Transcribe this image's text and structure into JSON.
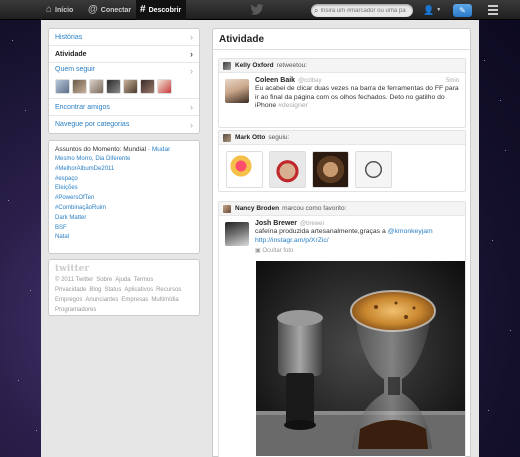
{
  "topbar": {
    "nav": [
      {
        "label": "Início",
        "icon": "home-icon"
      },
      {
        "label": "Conectar",
        "icon": "at-icon"
      },
      {
        "label": "Descobrir",
        "icon": "hash-icon"
      }
    ],
    "search_placeholder": "Insira um #marcador ou uma pal"
  },
  "sidebar": {
    "menu": [
      {
        "label": "Histórias",
        "active": false
      },
      {
        "label": "Atividade",
        "active": true
      }
    ],
    "who_to_follow": "Quem seguir",
    "menu_after": [
      {
        "label": "Encontrar amigos"
      },
      {
        "label": "Navegue por categorias"
      }
    ],
    "trends": {
      "title": "Assuntos do Momento: Mundial",
      "change": "Mudar",
      "items": [
        "Mesmo Morro, Dia Diferente",
        "#MelhorAlbumDe2011",
        "#espaço",
        "Eleições",
        "#PowersOfTen",
        "#CombinaçãoRuim",
        "Dark Matter",
        "BSF",
        "Natal"
      ]
    },
    "footer": {
      "logo": "twitter",
      "links": [
        "© 2011 Twitter",
        "Sobre",
        "Ajuda",
        "Termos",
        "Privacidade",
        "Blog",
        "Status",
        "Aplicativos",
        "Recursos",
        "Empregos",
        "Anunciantes",
        "Empresas",
        "Multimídia",
        "Programadores"
      ]
    }
  },
  "main": {
    "title": "Atividade",
    "activities": [
      {
        "actor": "Kelly Oxford",
        "action": "retweetou:",
        "tweet": {
          "name": "Coleen Baik",
          "handle": "@colbay",
          "time": "5min",
          "text": "Eu acabei de clicar duas vezes na barra de ferramentas do FF para ir ao final da página com os olhos fechados. Deto no gatilho do iPhone",
          "hashtag": "#designer"
        }
      },
      {
        "actor": "Mark Otto",
        "action": "seguiu:"
      },
      {
        "actor": "Nancy Broden",
        "action": "marcou como favorito:",
        "tweet": {
          "name": "Josh Brewer",
          "handle": "@brewer",
          "text": "cafeína produzida artesanalmente,graças a",
          "mention": "@kmonkeyjam",
          "link": "http://instagr.am/p/XrZic/",
          "hide_photo": "Ocultar foto"
        }
      }
    ]
  },
  "colors": {
    "link": "#2a7fc4",
    "compose": "#2c78c8"
  }
}
